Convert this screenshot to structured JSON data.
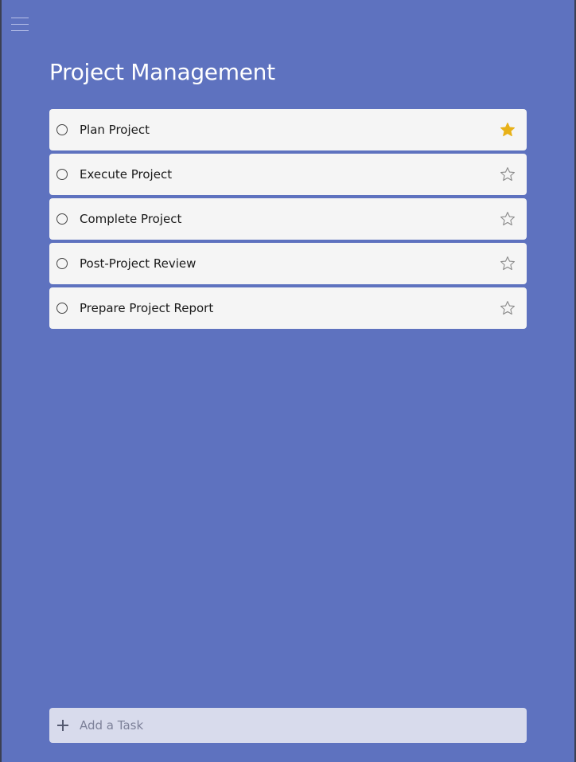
{
  "page": {
    "title": "Project Management"
  },
  "tasks": [
    {
      "label": "Plan Project",
      "important": true
    },
    {
      "label": "Execute Project",
      "important": false
    },
    {
      "label": "Complete Project",
      "important": false
    },
    {
      "label": "Post-Project Review",
      "important": false
    },
    {
      "label": "Prepare Project Report",
      "important": false
    }
  ],
  "add_task": {
    "placeholder": "Add a Task"
  },
  "icons": {
    "menu": "hamburger-menu-icon",
    "complete": "circle-checkbox-icon",
    "important": "star-icon",
    "add": "plus-icon"
  },
  "colors": {
    "background": "#5e72bf",
    "star_filled": "#e8b118",
    "star_outline": "#8a8a8a",
    "card": "#f5f5f5",
    "add_bar": "#d8dbec"
  }
}
